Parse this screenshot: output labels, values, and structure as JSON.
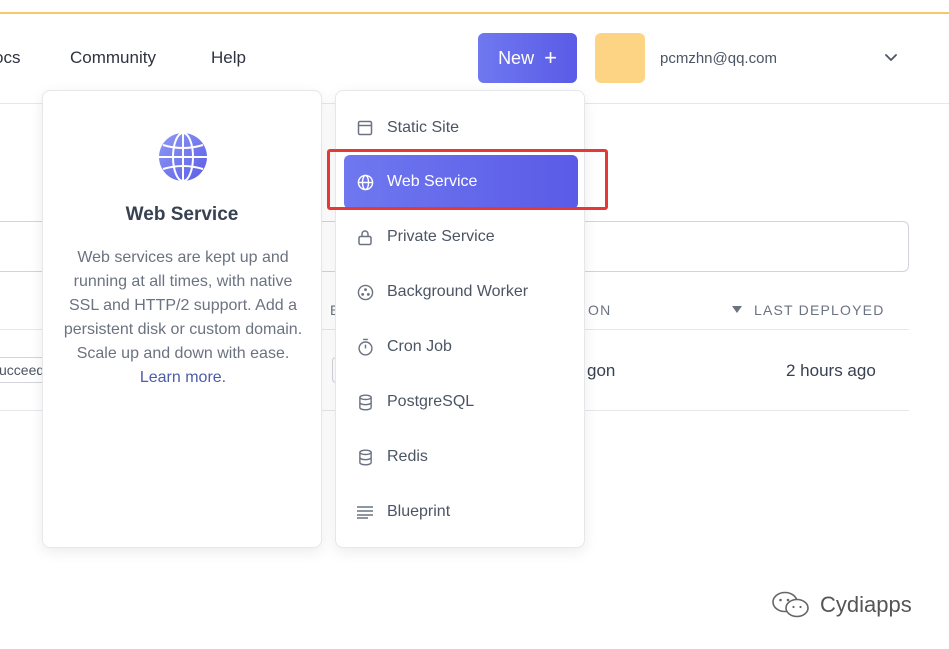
{
  "header": {
    "nav": [
      "ocs",
      "Community",
      "Help"
    ],
    "new_button": {
      "label": "New",
      "icon": "+"
    },
    "email": "pcmzhn@qq.com"
  },
  "table": {
    "headers": [
      "E",
      "ON",
      "LAST DEPLOYED"
    ],
    "row": {
      "status": "ucceed",
      "col_on": "gon",
      "last_deployed": "2 hours ago"
    }
  },
  "info_card": {
    "title": "Web Service",
    "description": "Web services are kept up and running at all times, with native SSL and HTTP/2 support. Add a persistent disk or custom domain. Scale up and down with ease.",
    "link": "Learn more."
  },
  "menu": {
    "items": [
      {
        "label": "Static Site",
        "icon": "window-icon"
      },
      {
        "label": "Web Service",
        "icon": "globe-icon",
        "active": true
      },
      {
        "label": "Private Service",
        "icon": "lock-icon"
      },
      {
        "label": "Background Worker",
        "icon": "worker-icon"
      },
      {
        "label": "Cron Job",
        "icon": "stopwatch-icon"
      },
      {
        "label": "PostgreSQL",
        "icon": "database-icon"
      },
      {
        "label": "Redis",
        "icon": "database-icon"
      },
      {
        "label": "Blueprint",
        "icon": "lines-icon"
      }
    ]
  },
  "watermark": {
    "text": "Cydiapps",
    "icon": "wechat-icon"
  },
  "colors": {
    "accent": "#5a5be7",
    "highlight": "#e53935",
    "avatar": "#fcd484",
    "banner": "#f5c86a"
  }
}
